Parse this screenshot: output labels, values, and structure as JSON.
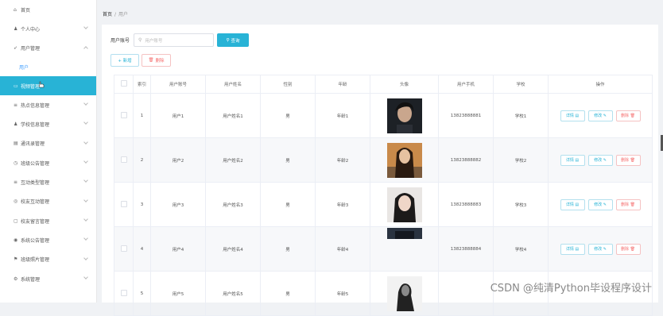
{
  "sidebar": {
    "items": [
      {
        "label": "首页",
        "icon": "home-icon",
        "glyph": "⌂"
      },
      {
        "label": "个人中心",
        "icon": "user-icon",
        "glyph": "♟"
      },
      {
        "label": "用户管理",
        "icon": "send-icon",
        "glyph": "➶"
      },
      {
        "label": "用户",
        "sub": true
      },
      {
        "label": "视频管理",
        "active": true,
        "icon": "video-icon",
        "glyph": "▭"
      },
      {
        "label": "热点信息管理",
        "icon": "list-icon",
        "glyph": "≡"
      },
      {
        "label": "学校信息管理",
        "icon": "person-icon",
        "glyph": "♟"
      },
      {
        "label": "通讯录管理",
        "icon": "card-icon",
        "glyph": "▤"
      },
      {
        "label": "班级公告管理",
        "icon": "clock-icon",
        "glyph": "◷"
      },
      {
        "label": "互动类型管理",
        "icon": "list-icon",
        "glyph": "≡"
      },
      {
        "label": "校友互动管理",
        "icon": "circle-icon",
        "glyph": "◎"
      },
      {
        "label": "校友留言管理",
        "icon": "message-icon",
        "glyph": "▢"
      },
      {
        "label": "系统公告管理",
        "icon": "check-circle-icon",
        "glyph": "◉"
      },
      {
        "label": "班级照片管理",
        "icon": "flag-icon",
        "glyph": "⚑"
      },
      {
        "label": "系统管理",
        "icon": "settings-icon",
        "glyph": "⚙"
      }
    ]
  },
  "breadcrumb": {
    "home": "首页",
    "sep": "/",
    "current": "用户"
  },
  "search": {
    "label": "用户账号",
    "placeholder": "用户账号",
    "button": "查询"
  },
  "actions": {
    "add": "+ 新增",
    "delete": "删除"
  },
  "table": {
    "headers": [
      "索引",
      "用户账号",
      "用户姓名",
      "性别",
      "年龄",
      "头像",
      "用户手机",
      "学校",
      "操作"
    ],
    "rows": [
      {
        "index": "1",
        "account": "用户1",
        "name": "用户姓名1",
        "gender": "男",
        "age": "年龄1",
        "phone": "13823888881",
        "school": "学校1"
      },
      {
        "index": "2",
        "account": "用户2",
        "name": "用户姓名2",
        "gender": "男",
        "age": "年龄2",
        "phone": "13823888882",
        "school": "学校2"
      },
      {
        "index": "3",
        "account": "用户3",
        "name": "用户姓名3",
        "gender": "男",
        "age": "年龄3",
        "phone": "13823888883",
        "school": "学校3"
      },
      {
        "index": "4",
        "account": "用户4",
        "name": "用户姓名4",
        "gender": "男",
        "age": "年龄4",
        "phone": "13823888884",
        "school": "学校4"
      },
      {
        "index": "5",
        "account": "用户5",
        "name": "用户姓名5",
        "gender": "男",
        "age": "年龄5",
        "phone": "",
        "school": ""
      }
    ],
    "ops": {
      "detail": "详情",
      "edit": "修改",
      "delete": "删除"
    }
  },
  "watermark": "CSDN @纯清Python毕设程序设计",
  "colors": {
    "accent": "#28b3d6",
    "danger": "#f56c6c",
    "link": "#409eff"
  }
}
